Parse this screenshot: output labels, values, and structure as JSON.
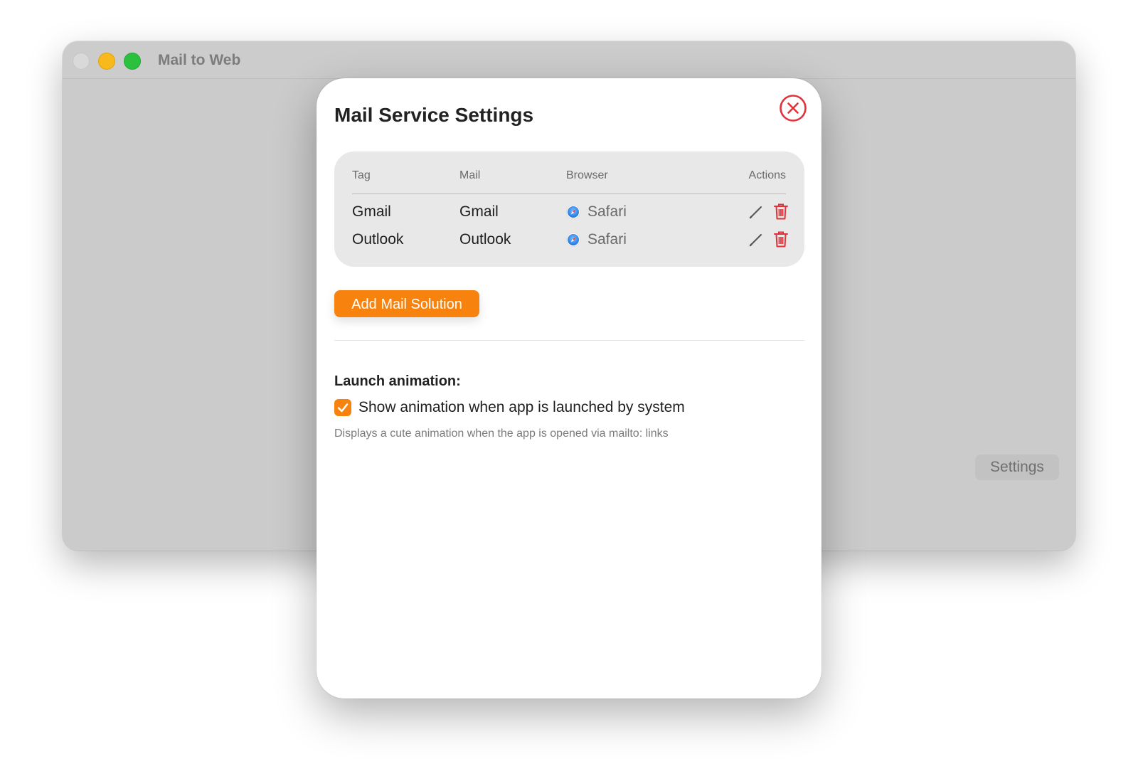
{
  "window": {
    "title": "Mail to Web",
    "settings_button": "Settings"
  },
  "sheet": {
    "title": "Mail Service Settings",
    "close_icon": "close-circle-icon",
    "table": {
      "headers": {
        "tag": "Tag",
        "mail": "Mail",
        "browser": "Browser",
        "actions": "Actions"
      },
      "rows": [
        {
          "tag": "Gmail",
          "mail": "Gmail",
          "browser": "Safari",
          "browser_icon": "safari-icon"
        },
        {
          "tag": "Outlook",
          "mail": "Outlook",
          "browser": "Safari",
          "browser_icon": "safari-icon"
        }
      ],
      "row_actions": [
        "pencil-icon",
        "trash-icon"
      ]
    },
    "add_button": "Add Mail Solution",
    "launch_animation": {
      "title": "Launch animation:",
      "checkbox_label": "Show animation when app is launched by system",
      "checked": true,
      "helper": "Displays a cute animation when the app is opened via mailto: links"
    }
  },
  "colors": {
    "accent": "#f7820e",
    "danger": "#e0323a",
    "traffic_min": "#f8b91c",
    "traffic_max": "#2bc13f"
  }
}
